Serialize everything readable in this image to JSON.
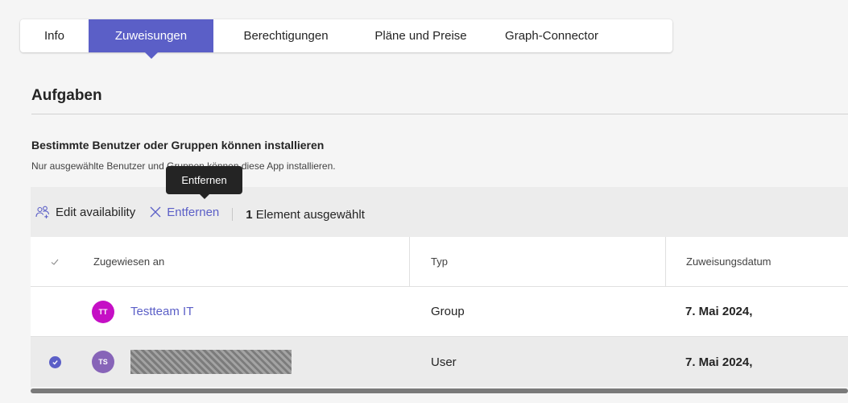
{
  "tabs": [
    {
      "label": "Info"
    },
    {
      "label": "Zuweisungen"
    },
    {
      "label": "Berechtigungen"
    },
    {
      "label": "Pläne und Preise"
    },
    {
      "label": "Graph-Connector"
    }
  ],
  "active_tab": "Zuweisungen",
  "page_title": "Aufgaben",
  "section": {
    "title": "Bestimmte Benutzer oder Gruppen können installieren",
    "description": "Nur ausgewählte Benutzer und Gruppen können diese App installieren."
  },
  "tooltip": "Entfernen",
  "toolbar": {
    "edit_label": "Edit availability",
    "remove_label": "Entfernen",
    "selected_count": "1",
    "selected_suffix": "Element ausgewählt"
  },
  "table": {
    "columns": [
      "Zugewiesen an",
      "Typ",
      "Zuweisungsdatum"
    ],
    "rows": [
      {
        "initials": "TT",
        "avatar_color": "#c50fc5",
        "name": "Testteam IT",
        "type": "Group",
        "date": "7. Mai 2024,",
        "selected": false,
        "name_redacted": false
      },
      {
        "initials": "TS",
        "avatar_color": "#8764b8",
        "name": "",
        "type": "User",
        "date": "7. Mai 2024,",
        "selected": true,
        "name_redacted": true
      }
    ]
  },
  "colors": {
    "accent": "#5b5fc7",
    "background": "#f5f5f5"
  }
}
